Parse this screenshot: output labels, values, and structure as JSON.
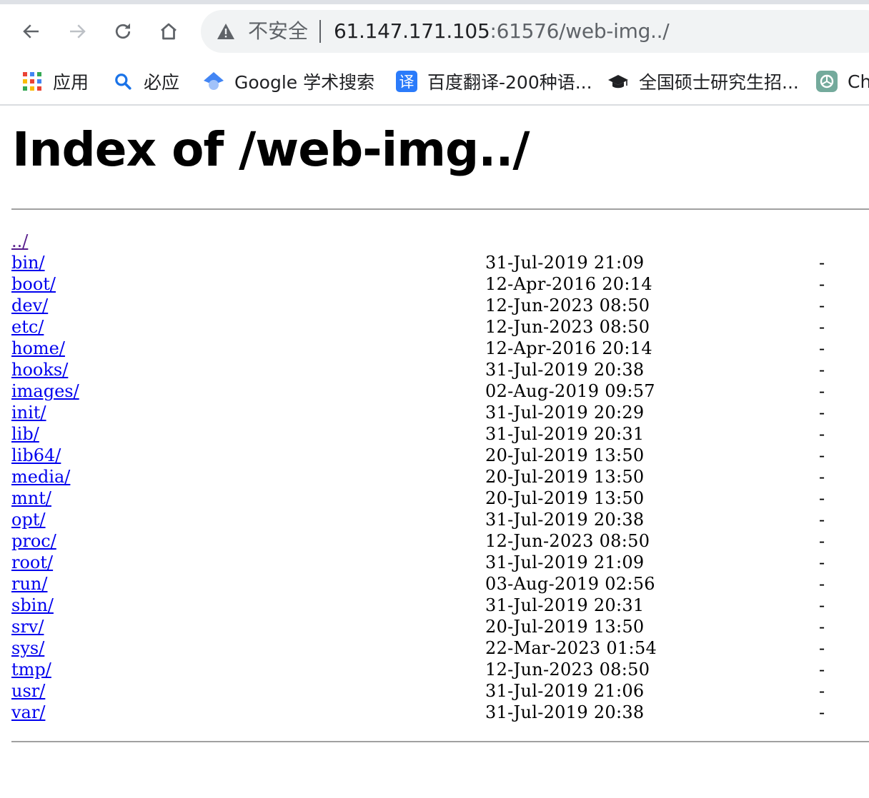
{
  "browser": {
    "security_label": "不安全",
    "url_host": "61.147.171.105",
    "url_rest": ":61576/web-img../"
  },
  "bookmarks": [
    {
      "label": "应用",
      "icon": "apps-grid-icon"
    },
    {
      "label": "必应",
      "icon": "bing-search-icon"
    },
    {
      "label": "Google 学术搜索",
      "icon": "google-scholar-icon"
    },
    {
      "label": "百度翻译-200种语...",
      "icon": "baidu-translate-icon"
    },
    {
      "label": "全国硕士研究生招...",
      "icon": "graduation-cap-icon"
    },
    {
      "label": "Ch",
      "icon": "chatgpt-icon"
    }
  ],
  "page": {
    "title": "Index of /web-img../",
    "entries": [
      {
        "name": "../",
        "date": "",
        "size": ""
      },
      {
        "name": "bin/",
        "date": "31-Jul-2019 21:09",
        "size": "-"
      },
      {
        "name": "boot/",
        "date": "12-Apr-2016 20:14",
        "size": "-"
      },
      {
        "name": "dev/",
        "date": "12-Jun-2023 08:50",
        "size": "-"
      },
      {
        "name": "etc/",
        "date": "12-Jun-2023 08:50",
        "size": "-"
      },
      {
        "name": "home/",
        "date": "12-Apr-2016 20:14",
        "size": "-"
      },
      {
        "name": "hooks/",
        "date": "31-Jul-2019 20:38",
        "size": "-"
      },
      {
        "name": "images/",
        "date": "02-Aug-2019 09:57",
        "size": "-"
      },
      {
        "name": "init/",
        "date": "31-Jul-2019 20:29",
        "size": "-"
      },
      {
        "name": "lib/",
        "date": "31-Jul-2019 20:31",
        "size": "-"
      },
      {
        "name": "lib64/",
        "date": "20-Jul-2019 13:50",
        "size": "-"
      },
      {
        "name": "media/",
        "date": "20-Jul-2019 13:50",
        "size": "-"
      },
      {
        "name": "mnt/",
        "date": "20-Jul-2019 13:50",
        "size": "-"
      },
      {
        "name": "opt/",
        "date": "31-Jul-2019 20:38",
        "size": "-"
      },
      {
        "name": "proc/",
        "date": "12-Jun-2023 08:50",
        "size": "-"
      },
      {
        "name": "root/",
        "date": "31-Jul-2019 21:09",
        "size": "-"
      },
      {
        "name": "run/",
        "date": "03-Aug-2019 02:56",
        "size": "-"
      },
      {
        "name": "sbin/",
        "date": "31-Jul-2019 20:31",
        "size": "-"
      },
      {
        "name": "srv/",
        "date": "20-Jul-2019 13:50",
        "size": "-"
      },
      {
        "name": "sys/",
        "date": "22-Mar-2023 01:54",
        "size": "-"
      },
      {
        "name": "tmp/",
        "date": "12-Jun-2023 08:50",
        "size": "-"
      },
      {
        "name": "usr/",
        "date": "31-Jul-2019 21:06",
        "size": "-"
      },
      {
        "name": "var/",
        "date": "31-Jul-2019 20:38",
        "size": "-"
      }
    ]
  },
  "colors": {
    "link": "#0000ee",
    "visited_link": "#551a8b",
    "rule": "#a0a0a0"
  }
}
